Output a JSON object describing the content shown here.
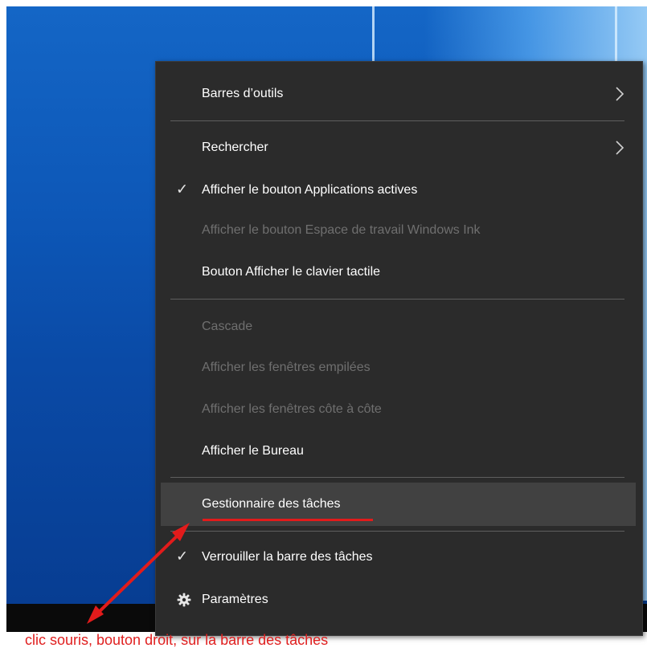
{
  "menu": {
    "items": [
      {
        "label": "Barres d’outils",
        "submenu": true,
        "checked": false,
        "disabled": false
      },
      {
        "label": "Rechercher",
        "submenu": true,
        "checked": false,
        "disabled": false
      },
      {
        "label": "Afficher le bouton Applications actives",
        "submenu": false,
        "checked": true,
        "disabled": false
      },
      {
        "label": "Afficher le bouton Espace de travail Windows Ink",
        "submenu": false,
        "checked": false,
        "disabled": true
      },
      {
        "label": "Bouton Afficher le clavier tactile",
        "submenu": false,
        "checked": false,
        "disabled": false
      },
      {
        "label": "Cascade",
        "submenu": false,
        "checked": false,
        "disabled": true
      },
      {
        "label": "Afficher les fenêtres empilées",
        "submenu": false,
        "checked": false,
        "disabled": true
      },
      {
        "label": "Afficher les fenêtres côte à côte",
        "submenu": false,
        "checked": false,
        "disabled": true
      },
      {
        "label": "Afficher le Bureau",
        "submenu": false,
        "checked": false,
        "disabled": false
      },
      {
        "label": "Gestionnaire des tâches",
        "submenu": false,
        "checked": false,
        "disabled": false,
        "highlighted": true
      },
      {
        "label": "Verrouiller la barre des tâches",
        "submenu": false,
        "checked": true,
        "disabled": false
      },
      {
        "label": "Paramètres",
        "submenu": false,
        "checked": false,
        "disabled": false,
        "icon": "gear-icon"
      }
    ]
  },
  "annotation": {
    "caption": "clic souris, bouton droit, sur la barre des tâches",
    "color": "#e21b1b"
  },
  "colors": {
    "menu_bg": "#2b2b2b",
    "hover_bg": "#414141",
    "disabled_text": "#6f6f6f",
    "desktop_blue": "#0d57b7"
  }
}
